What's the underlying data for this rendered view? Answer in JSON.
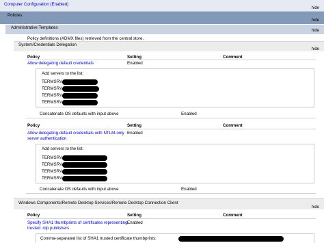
{
  "hide_label": "hide",
  "computer_config": {
    "title": "Computer Configuration (Enabled)"
  },
  "policies": {
    "title": "Policies"
  },
  "admin_templates": {
    "title": "Administrative Templates",
    "note": "Policy definitions (ADMX files) retrieved from the central store."
  },
  "cred_section": {
    "title": "System/Credentials Delegation"
  },
  "table_headers": {
    "policy": "Policy",
    "setting": "Setting",
    "comment": "Comment"
  },
  "policy1": {
    "name": "Allow delegating default credentials",
    "setting": "Enabled",
    "list_label": "Add servers to the list:",
    "servers": [
      "TERMSRV/",
      "TERMSRV/",
      "TERMSRV/",
      "TERMSRV/"
    ],
    "concat_label": "Concatenate OS defaults with input above",
    "concat_value": "Enabled"
  },
  "policy2": {
    "name_line1": "Allow delegating default credentials with NTLM-only",
    "name_line2": "server authentication",
    "setting": "Enabled",
    "list_label": "Add servers to the list:",
    "servers": [
      "TERMSRV/",
      "TERMSRV/",
      "TERMSRV/",
      "TERMSRV/"
    ],
    "concat_label": "Concatenate OS defaults with input above",
    "concat_value": "Enabled"
  },
  "rdc_section": {
    "title": "Windows Components/Remote Desktop Services/Remote Desktop Connection Client"
  },
  "policy3": {
    "name_line1": "Specify SHA1 thumbprints of certificates representing",
    "name_line2": "trusted .rdp publishers",
    "setting": "Enabled",
    "list_label": "Comma-separated list of SHA1 trusted certificate thumbprints:"
  },
  "colors": {
    "computer_band": "#e6ebf3",
    "policies_band": "#8399b8",
    "admin_band": "#c9d3e2",
    "section_band": "#ececec",
    "link": "#0000cc"
  }
}
